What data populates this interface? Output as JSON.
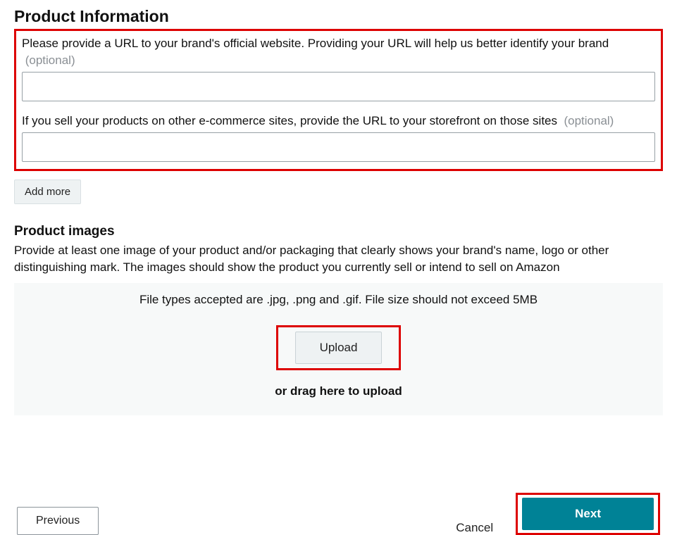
{
  "section": {
    "title": "Product Information",
    "url_label_main": "Please provide a URL to your brand's official website. Providing your URL will help us better identify your brand",
    "url_label_optional": "(optional)",
    "url_value": "",
    "storefront_label_main": "If you sell your products on other e-commerce sites, provide the URL to your storefront on those sites",
    "storefront_label_optional": "(optional)",
    "storefront_value": "",
    "add_more_label": "Add more"
  },
  "images": {
    "title": "Product images",
    "description": "Provide at least one image of your product and/or packaging that clearly shows your brand's name, logo or other distinguishing mark. The images should show the product you currently sell or intend to sell on Amazon",
    "file_hint": "File types accepted are .jpg, .png and .gif.    File size should not exceed 5MB",
    "upload_label": "Upload",
    "drag_text": "or drag here to upload"
  },
  "footer": {
    "previous_label": "Previous",
    "cancel_label": "Cancel",
    "next_label": "Next"
  }
}
